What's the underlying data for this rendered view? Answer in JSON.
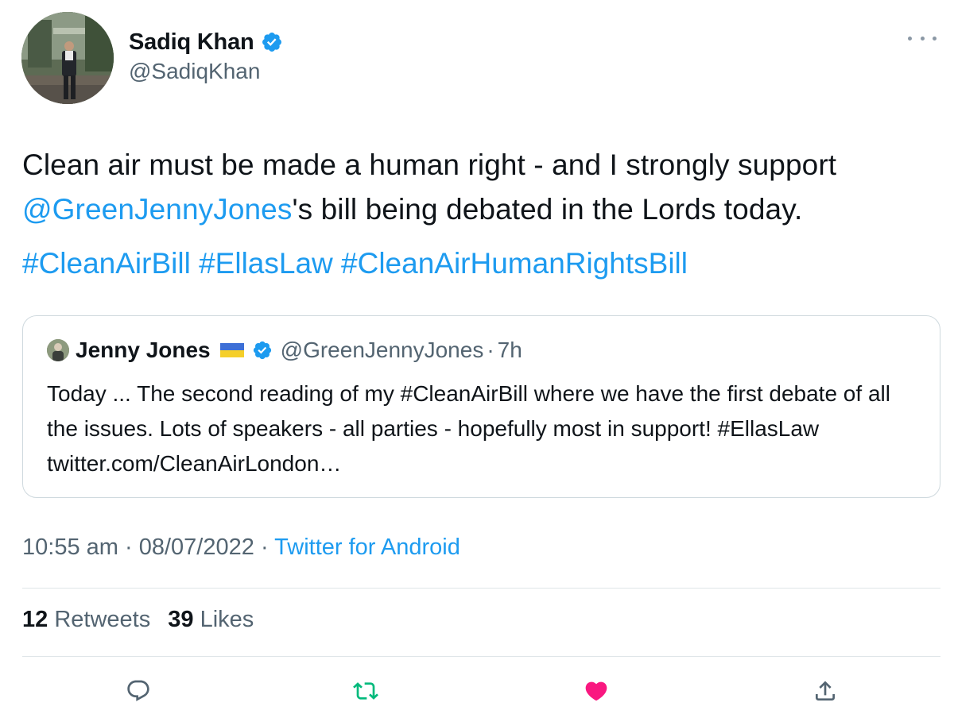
{
  "author": {
    "name": "Sadiq Khan",
    "handle": "@SadiqKhan",
    "verified": true
  },
  "tweet": {
    "text_before_mention": "Clean air must be made a human right - and I strongly support",
    "mention": "@GreenJennyJones",
    "text_after_mention": "'s bill being debated in the Lords today.",
    "hashtags": [
      "#CleanAirBill",
      "#EllasLaw",
      "#CleanAirHumanRightsBill"
    ]
  },
  "quoted_tweet": {
    "name": "Jenny Jones",
    "handle": "@GreenJennyJones",
    "separator": "·",
    "time": "7h",
    "text": "Today ... The second reading of my #CleanAirBill where we have the first debate of all the issues. Lots of speakers - all parties - hopefully most in support! #EllasLaw twitter.com/CleanAirLondon…"
  },
  "meta": {
    "time": "10:55 am",
    "date": "08/07/2022",
    "separator": "·",
    "source": "Twitter for Android"
  },
  "stats": {
    "retweets_count": "12",
    "retweets_label": "Retweets",
    "likes_count": "39",
    "likes_label": "Likes"
  },
  "actions": {
    "reply_icon": "reply-icon",
    "retweet_icon": "retweet-icon",
    "like_icon": "heart-icon",
    "share_icon": "share-icon"
  },
  "colors": {
    "link": "#1d9bf0",
    "retweet_green": "#00ba7c",
    "like_pink": "#f91880",
    "secondary_text": "#536471"
  }
}
